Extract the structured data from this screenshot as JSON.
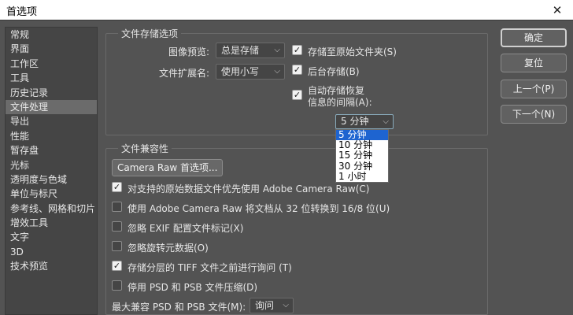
{
  "window": {
    "title": "首选项",
    "close_glyph": "✕"
  },
  "sidebar": {
    "items": [
      {
        "label": "常规"
      },
      {
        "label": "界面"
      },
      {
        "label": "工作区"
      },
      {
        "label": "工具"
      },
      {
        "label": "历史记录"
      },
      {
        "label": "文件处理",
        "active": true
      },
      {
        "label": "导出"
      },
      {
        "label": "性能"
      },
      {
        "label": "暂存盘"
      },
      {
        "label": "光标"
      },
      {
        "label": "透明度与色域"
      },
      {
        "label": "单位与标尺"
      },
      {
        "label": "参考线、网格和切片"
      },
      {
        "label": "增效工具"
      },
      {
        "label": "文字"
      },
      {
        "label": "3D"
      },
      {
        "label": "技术预览"
      }
    ]
  },
  "file_saving": {
    "legend": "文件存储选项",
    "image_preview_label": "图像预览:",
    "image_preview_value": "总是存储",
    "extension_label": "文件扩展名:",
    "extension_value": "使用小写",
    "save_original_folder": {
      "label": "存储至原始文件夹(S)",
      "checked": true
    },
    "background_save": {
      "label": "后台存储(B)",
      "checked": true
    },
    "autosave_line1": "自动存储恢复",
    "autosave_line2": "信息的间隔(A):",
    "autosave_checked": true,
    "interval_value": "5 分钟",
    "interval_options": [
      "5 分钟",
      "10 分钟",
      "15 分钟",
      "30 分钟",
      "1 小时"
    ]
  },
  "compat": {
    "legend": "文件兼容性",
    "camera_raw_button": "Camera Raw 首选项...",
    "options": [
      {
        "label": "对支持的原始数据文件优先使用 Adobe Camera Raw(C)",
        "checked": true
      },
      {
        "label": "使用 Adobe Camera Raw 将文档从 32 位转换到 16/8 位(U)",
        "checked": false
      },
      {
        "label": "忽略 EXIF 配置文件标记(X)",
        "checked": false
      },
      {
        "label": "忽略旋转元数据(O)",
        "checked": false
      },
      {
        "label": "存储分层的 TIFF 文件之前进行询问 (T)",
        "checked": true
      },
      {
        "label": "停用 PSD 和 PSB 文件压缩(D)",
        "checked": false
      }
    ],
    "max_compat_label": "最大兼容 PSD 和 PSB 文件(M):",
    "max_compat_value": "询问"
  },
  "buttons": {
    "ok": "确定",
    "reset": "复位",
    "prev": "上一个(P)",
    "next": "下一个(N)"
  }
}
